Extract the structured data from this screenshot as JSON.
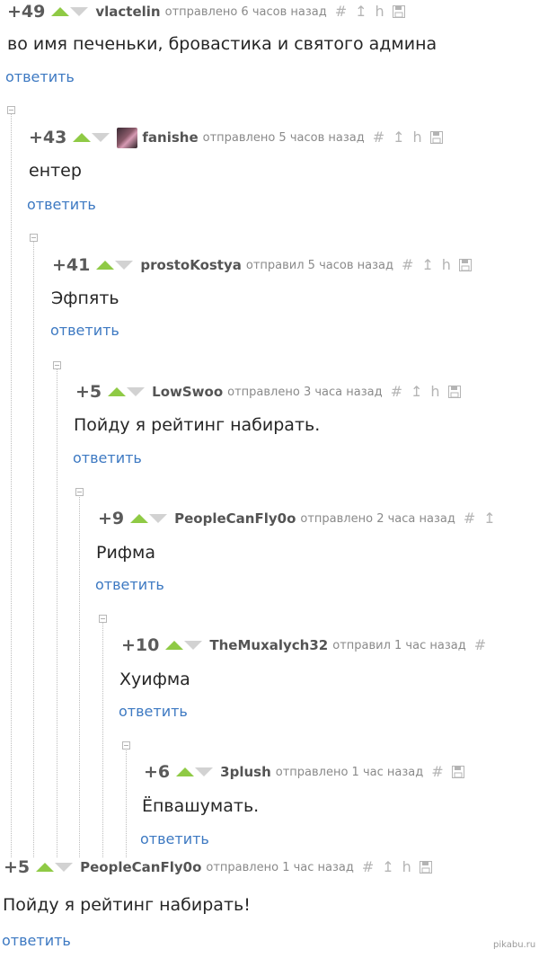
{
  "colors": {
    "vote_up": "#8fca45",
    "vote_down": "#d2d2d2",
    "link": "#3d79c2",
    "author": "#545454",
    "meta": "#8a8a8a"
  },
  "icons": [
    "hash-icon",
    "arrow-up-icon",
    "branch-icon",
    "save-icon"
  ],
  "comments": [
    {
      "rating": "+49",
      "author": "vlactelin",
      "meta": "отправлено 6 часов назад",
      "text": "во имя печеньки, бровастика и святого админа",
      "reply": "ответить"
    },
    {
      "rating": "+43",
      "author": "fanishe",
      "meta": "отправлено 5 часов назад",
      "text": "ентер",
      "reply": "ответить"
    },
    {
      "rating": "+41",
      "author": "prostoKostya",
      "meta": "отправил 5 часов назад",
      "text": "Эфпять",
      "reply": "ответить"
    },
    {
      "rating": "+5",
      "author": "LowSwoo",
      "meta": "отправлено 3 часа назад",
      "text": "Пойду я рейтинг набирать.",
      "reply": "ответить"
    },
    {
      "rating": "+9",
      "author": "PeopleCanFly0o",
      "meta": "отправлено 2 часа назад",
      "text": "Рифма",
      "reply": "ответить"
    },
    {
      "rating": "+10",
      "author": "TheMuxalych32",
      "meta": "отправил 1 час назад",
      "text": "Хуифма",
      "reply": "ответить"
    },
    {
      "rating": "+6",
      "author": "3plush",
      "meta": "отправлено 1 час назад",
      "text": "Ёпвашумать.",
      "reply": "ответить"
    },
    {
      "rating": "+5",
      "author": "PeopleCanFly0o",
      "meta": "отправлено 1 час назад",
      "text": "Пойду я рейтинг набирать!",
      "reply": "ответить"
    }
  ],
  "watermark": "pikabu.ru"
}
